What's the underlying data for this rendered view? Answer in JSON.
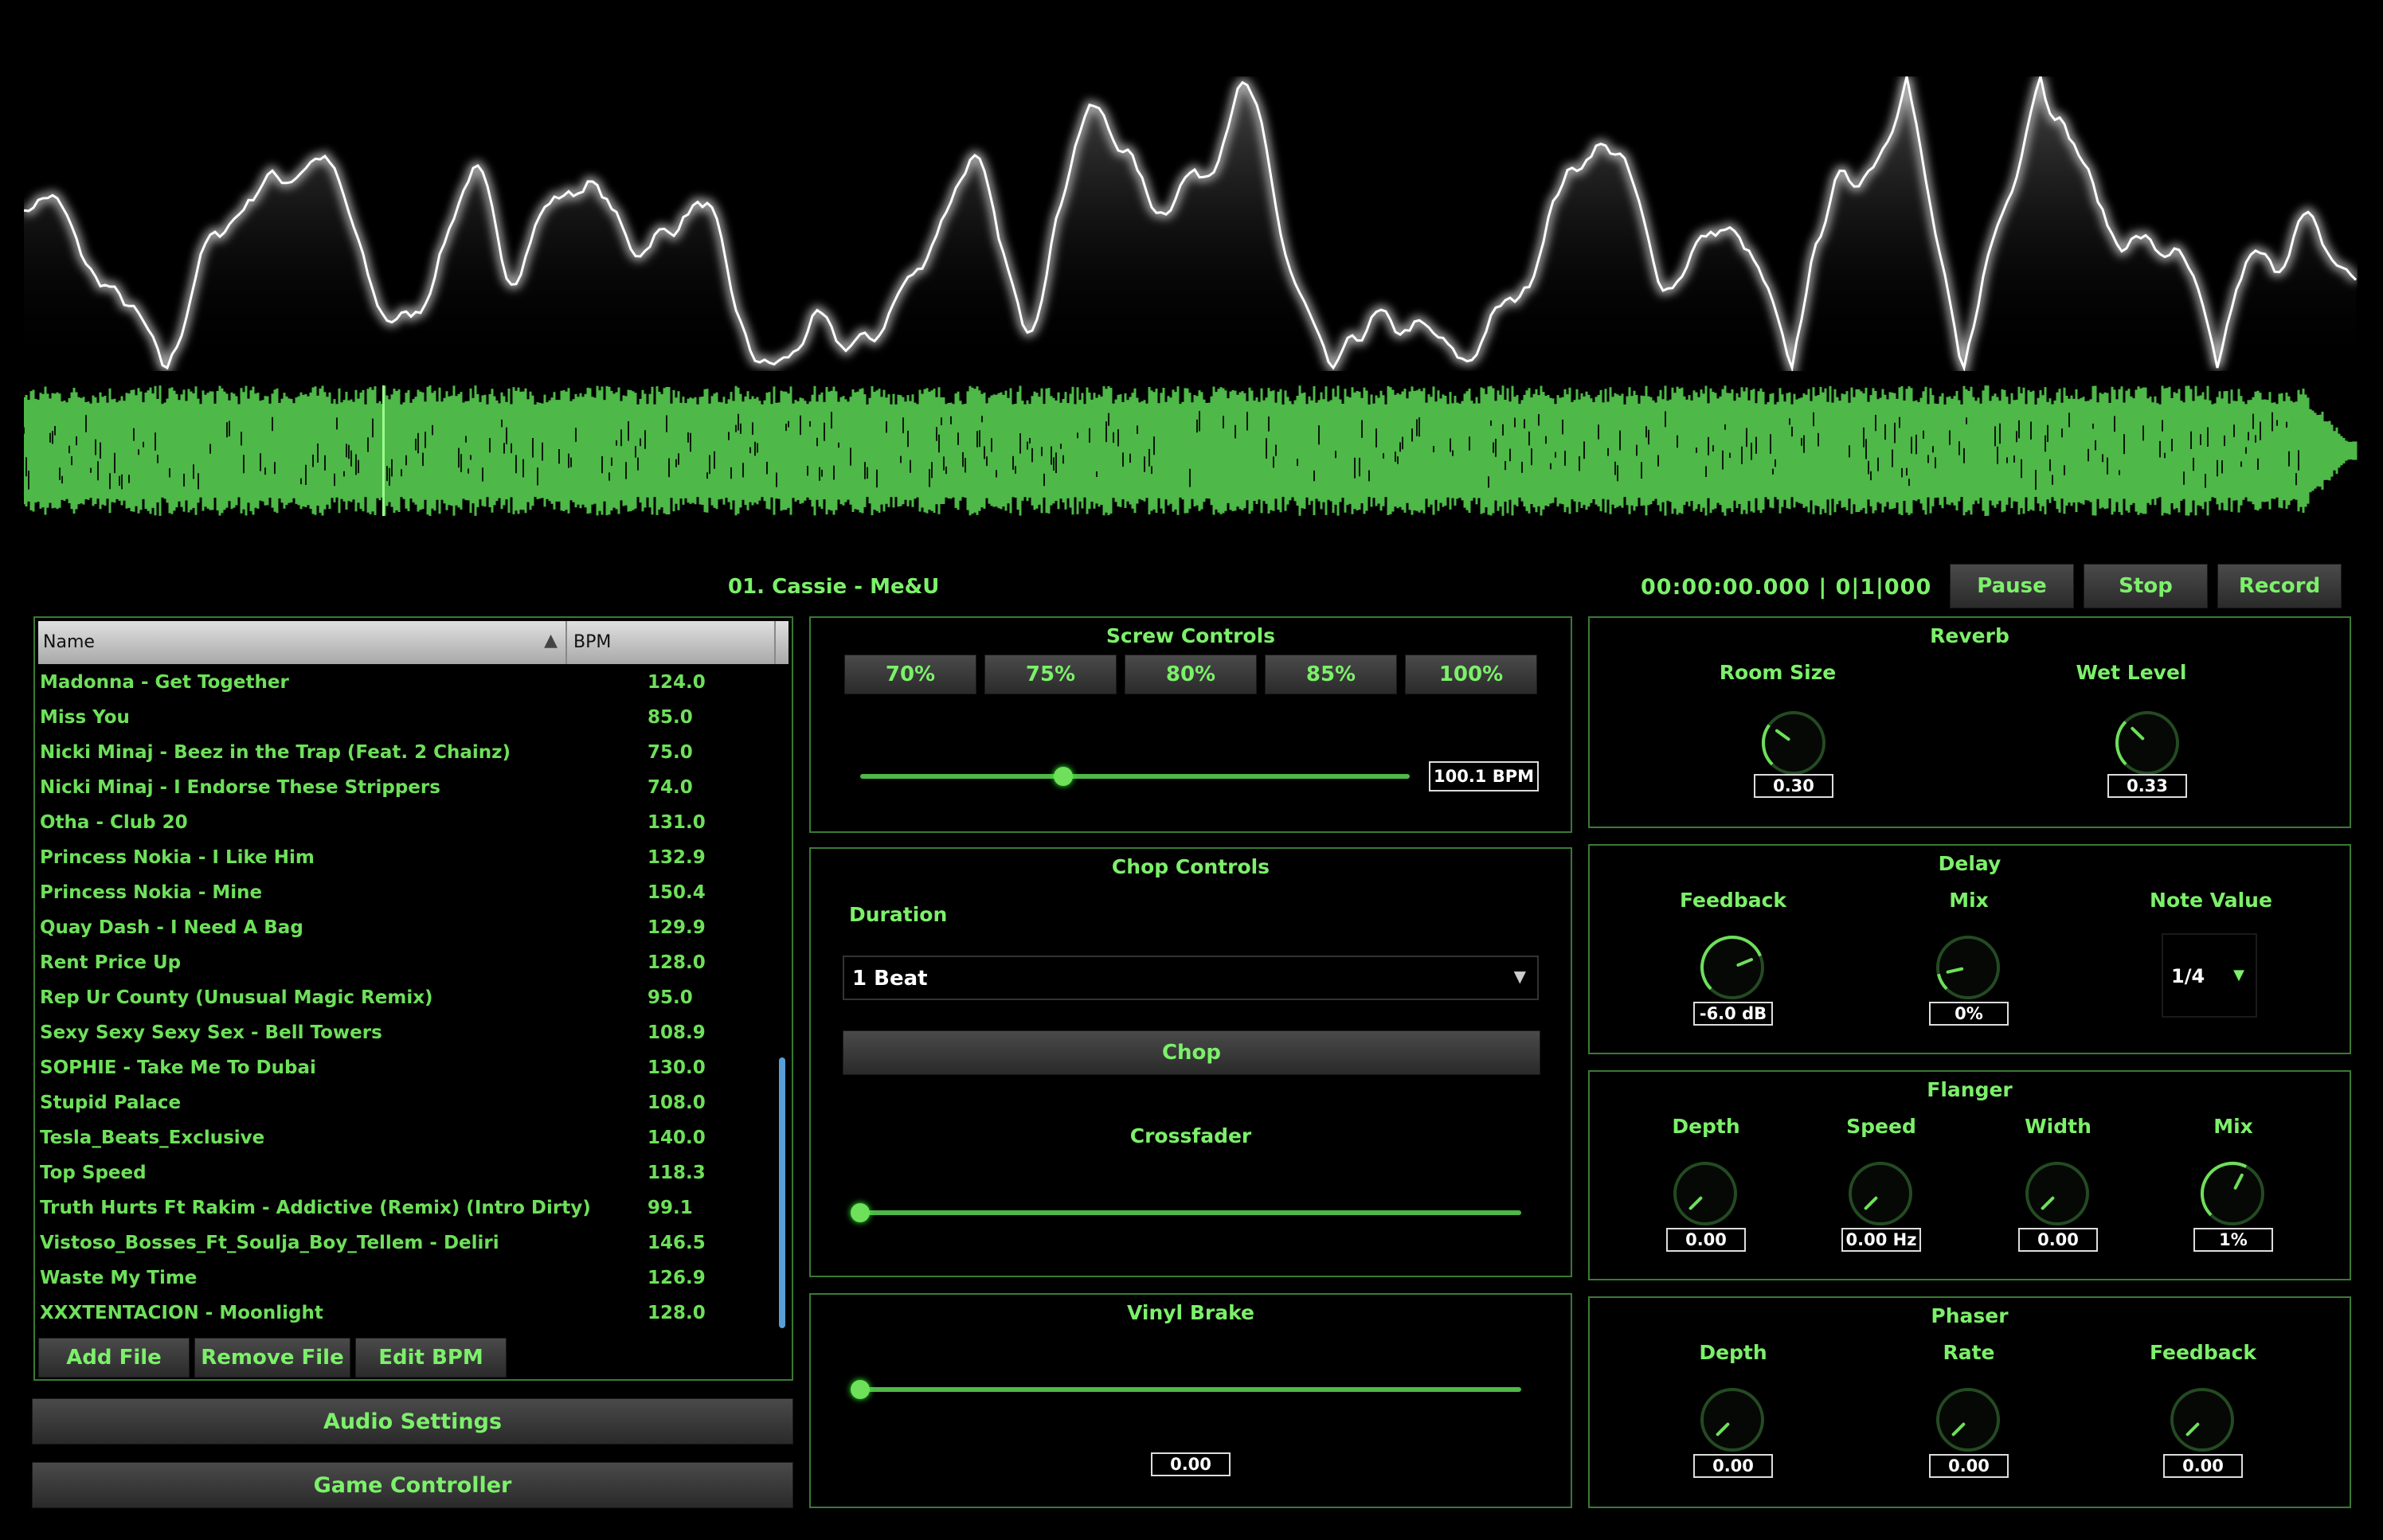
{
  "now_playing": "01. Cassie - Me&U",
  "time_display": "00:00:00.000 | 0|1|000",
  "transport": {
    "pause": "Pause",
    "stop": "Stop",
    "record": "Record"
  },
  "playlist": {
    "col_name": "Name",
    "col_bpm": "BPM",
    "rows": [
      {
        "name": "Madonna - Get Together",
        "bpm": "124.0"
      },
      {
        "name": "Miss You",
        "bpm": "85.0"
      },
      {
        "name": "Nicki Minaj - Beez in the Trap (Feat. 2 Chainz)",
        "bpm": "75.0"
      },
      {
        "name": "Nicki Minaj - I Endorse These Strippers",
        "bpm": "74.0"
      },
      {
        "name": "Otha - Club 20",
        "bpm": "131.0"
      },
      {
        "name": "Princess Nokia - I Like Him",
        "bpm": "132.9"
      },
      {
        "name": "Princess Nokia -  Mine",
        "bpm": "150.4"
      },
      {
        "name": "Quay Dash - I Need A Bag",
        "bpm": "129.9"
      },
      {
        "name": "Rent Price Up",
        "bpm": "128.0"
      },
      {
        "name": "Rep Ur County (Unusual Magic Remix)",
        "bpm": "95.0"
      },
      {
        "name": "Sexy Sexy Sexy Sex - Bell Towers",
        "bpm": "108.9"
      },
      {
        "name": "SOPHIE - Take Me To Dubai",
        "bpm": "130.0"
      },
      {
        "name": "Stupid Palace",
        "bpm": "108.0"
      },
      {
        "name": "Tesla_Beats_Exclusive",
        "bpm": "140.0"
      },
      {
        "name": "Top Speed",
        "bpm": "118.3"
      },
      {
        "name": "Truth Hurts Ft Rakim - Addictive (Remix) (Intro Dirty)",
        "bpm": "99.1"
      },
      {
        "name": "Vistoso_Bosses_Ft_Soulja_Boy_Tellem - Deliri",
        "bpm": "146.5"
      },
      {
        "name": "Waste My Time",
        "bpm": "126.9"
      },
      {
        "name": " XXXTENTACION - Moonlight",
        "bpm": "128.0"
      }
    ],
    "add_file": "Add File",
    "remove_file": "Remove File",
    "edit_bpm": "Edit BPM"
  },
  "audio_settings": "Audio Settings",
  "game_controller": "Game Controller",
  "screw": {
    "title": "Screw Controls",
    "presets": [
      "70%",
      "75%",
      "80%",
      "85%",
      "100%"
    ],
    "bpm_value": "100.1 BPM",
    "slider_fraction": 0.37
  },
  "chop": {
    "title": "Chop Controls",
    "duration_label": "Duration",
    "duration_value": "1 Beat",
    "chop_button": "Chop",
    "crossfader_label": "Crossfader",
    "crossfader_fraction": 0.0
  },
  "vinyl": {
    "title": "Vinyl Brake",
    "value": "0.00",
    "slider_fraction": 0.0
  },
  "reverb": {
    "title": "Reverb",
    "room_size_label": "Room Size",
    "room_size_value": "0.30",
    "wet_level_label": "Wet Level",
    "wet_level_value": "0.33"
  },
  "delay": {
    "title": "Delay",
    "feedback_label": "Feedback",
    "feedback_value": "-6.0 dB",
    "mix_label": "Mix",
    "mix_value": "0%",
    "note_label": "Note Value",
    "note_value": "1/4"
  },
  "flanger": {
    "title": "Flanger",
    "depth_label": "Depth",
    "depth_value": "0.00",
    "speed_label": "Speed",
    "speed_value": "0.00 Hz",
    "width_label": "Width",
    "width_value": "0.00",
    "mix_label": "Mix",
    "mix_value": "1%"
  },
  "phaser": {
    "title": "Phaser",
    "depth_label": "Depth",
    "depth_value": "0.00",
    "rate_label": "Rate",
    "rate_value": "0.00",
    "feedback_label": "Feedback",
    "feedback_value": "0.00"
  },
  "colors": {
    "accent": "#7cf06a",
    "waveform": "#4eb848",
    "panel_border": "#3a7a34"
  }
}
